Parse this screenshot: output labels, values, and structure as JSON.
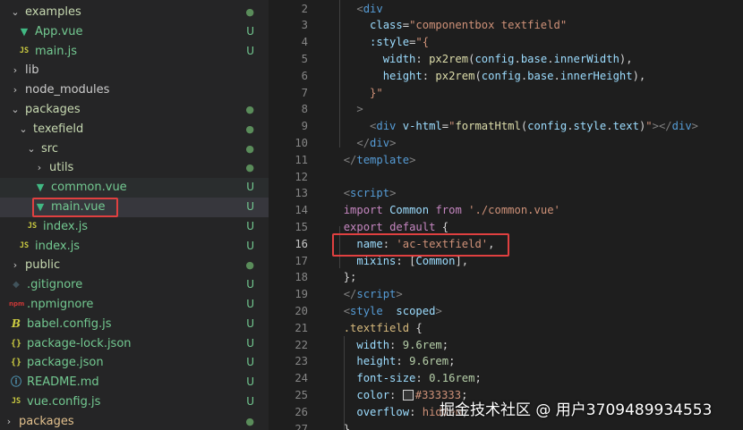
{
  "explorer": {
    "items": [
      {
        "label": "examples",
        "type": "folder-open",
        "depth": 0,
        "status": "dot",
        "style": "normal"
      },
      {
        "label": "App.vue",
        "type": "vue",
        "depth": 1,
        "status": "U",
        "style": "modified"
      },
      {
        "label": "main.js",
        "type": "js",
        "depth": 1,
        "status": "U",
        "style": "modified"
      },
      {
        "label": "lib",
        "type": "folder-closed",
        "depth": 0,
        "status": "",
        "style": "normal"
      },
      {
        "label": "node_modules",
        "type": "folder-closed",
        "depth": 0,
        "status": "",
        "style": "normal"
      },
      {
        "label": "packages",
        "type": "folder-open",
        "depth": 0,
        "status": "dot",
        "style": "normal"
      },
      {
        "label": "texefield",
        "type": "folder-open",
        "depth": 1,
        "status": "dot",
        "style": "normal"
      },
      {
        "label": "src",
        "type": "folder-open",
        "depth": 2,
        "status": "dot",
        "style": "normal"
      },
      {
        "label": "utils",
        "type": "folder-closed",
        "depth": 3,
        "status": "dot",
        "style": "normal"
      },
      {
        "label": "common.vue",
        "type": "vue",
        "depth": 3,
        "status": "U",
        "style": "modified"
      },
      {
        "label": "main.vue",
        "type": "vue",
        "depth": 3,
        "status": "U",
        "style": "modified"
      },
      {
        "label": "index.js",
        "type": "js",
        "depth": 2,
        "status": "U",
        "style": "modified"
      },
      {
        "label": "index.js",
        "type": "js",
        "depth": 1,
        "status": "U",
        "style": "modified"
      },
      {
        "label": "public",
        "type": "folder-closed",
        "depth": 0,
        "status": "dot",
        "style": "normal"
      },
      {
        "label": ".gitignore",
        "type": "git",
        "depth": 0,
        "status": "U",
        "style": "modified"
      },
      {
        "label": ".npmignore",
        "type": "npm",
        "depth": 0,
        "status": "U",
        "style": "modified"
      },
      {
        "label": "babel.config.js",
        "type": "babel",
        "depth": 0,
        "status": "U",
        "style": "modified"
      },
      {
        "label": "package-lock.json",
        "type": "json",
        "depth": 0,
        "status": "U",
        "style": "modified"
      },
      {
        "label": "package.json",
        "type": "json",
        "depth": 0,
        "status": "U",
        "style": "modified"
      },
      {
        "label": "README.md",
        "type": "info",
        "depth": 0,
        "status": "U",
        "style": "modified"
      },
      {
        "label": "vue.config.js",
        "type": "js",
        "depth": 0,
        "status": "U",
        "style": "modified"
      },
      {
        "label": "packages",
        "type": "folder-closed",
        "depth": -1,
        "status": "dot",
        "style": "bottom"
      }
    ],
    "selected_index": 10,
    "hover_index": 9
  },
  "editor": {
    "current_line": 16,
    "lines": [
      {
        "n": "2",
        "tokens": [
          [
            "    ",
            "t"
          ],
          [
            "<",
            "g"
          ],
          [
            "div",
            "tag"
          ]
        ]
      },
      {
        "n": "3",
        "tokens": [
          [
            "      ",
            "t"
          ],
          [
            "class",
            "attr"
          ],
          [
            "=",
            "t"
          ],
          [
            "\"componentbox textfield\"",
            "str"
          ]
        ]
      },
      {
        "n": "4",
        "tokens": [
          [
            "      ",
            "t"
          ],
          [
            ":style",
            "attr"
          ],
          [
            "=",
            "t"
          ],
          [
            "\"{",
            "str"
          ]
        ]
      },
      {
        "n": "5",
        "tokens": [
          [
            "        ",
            "t"
          ],
          [
            "width",
            "prop"
          ],
          [
            ": ",
            "t"
          ],
          [
            "px2rem",
            "fn"
          ],
          [
            "(",
            "t"
          ],
          [
            "config",
            "prop"
          ],
          [
            ".",
            "t"
          ],
          [
            "base",
            "prop"
          ],
          [
            ".",
            "t"
          ],
          [
            "innerWidth",
            "prop"
          ],
          [
            "),",
            "t"
          ]
        ]
      },
      {
        "n": "6",
        "tokens": [
          [
            "        ",
            "t"
          ],
          [
            "height",
            "prop"
          ],
          [
            ": ",
            "t"
          ],
          [
            "px2rem",
            "fn"
          ],
          [
            "(",
            "t"
          ],
          [
            "config",
            "prop"
          ],
          [
            ".",
            "t"
          ],
          [
            "base",
            "prop"
          ],
          [
            ".",
            "t"
          ],
          [
            "innerHeight",
            "prop"
          ],
          [
            "),",
            "t"
          ]
        ]
      },
      {
        "n": "7",
        "tokens": [
          [
            "      ",
            "t"
          ],
          [
            "}\"",
            "str"
          ]
        ]
      },
      {
        "n": "8",
        "tokens": [
          [
            "    ",
            "t"
          ],
          [
            ">",
            "g"
          ]
        ]
      },
      {
        "n": "9",
        "tokens": [
          [
            "      ",
            "t"
          ],
          [
            "<",
            "g"
          ],
          [
            "div",
            "tag"
          ],
          [
            " ",
            "t"
          ],
          [
            "v-html",
            "attr"
          ],
          [
            "=",
            "t"
          ],
          [
            "\"",
            "str"
          ],
          [
            "formatHtml",
            "fn"
          ],
          [
            "(",
            "t"
          ],
          [
            "config",
            "prop"
          ],
          [
            ".",
            "t"
          ],
          [
            "style",
            "prop"
          ],
          [
            ".",
            "t"
          ],
          [
            "text",
            "prop"
          ],
          [
            ")",
            "t"
          ],
          [
            "\"",
            "str"
          ],
          [
            "></",
            "g"
          ],
          [
            "div",
            "tag"
          ],
          [
            ">",
            "g"
          ]
        ]
      },
      {
        "n": "10",
        "tokens": [
          [
            "    ",
            "t"
          ],
          [
            "</",
            "g"
          ],
          [
            "div",
            "tag"
          ],
          [
            ">",
            "g"
          ]
        ]
      },
      {
        "n": "11",
        "tokens": [
          [
            "  ",
            "t"
          ],
          [
            "</",
            "g"
          ],
          [
            "template",
            "tag"
          ],
          [
            ">",
            "g"
          ]
        ]
      },
      {
        "n": "12",
        "tokens": []
      },
      {
        "n": "13",
        "tokens": [
          [
            "  ",
            "t"
          ],
          [
            "<",
            "g"
          ],
          [
            "script",
            "tag"
          ],
          [
            ">",
            "g"
          ]
        ]
      },
      {
        "n": "14",
        "tokens": [
          [
            "  ",
            "t"
          ],
          [
            "import",
            "kw"
          ],
          [
            " ",
            "t"
          ],
          [
            "Common",
            "prop"
          ],
          [
            " ",
            "t"
          ],
          [
            "from",
            "kw"
          ],
          [
            " ",
            "t"
          ],
          [
            "'./common.vue'",
            "str"
          ]
        ]
      },
      {
        "n": "15",
        "tokens": [
          [
            "  ",
            "t"
          ],
          [
            "export",
            "kw"
          ],
          [
            " ",
            "t"
          ],
          [
            "default",
            "kw"
          ],
          [
            " ",
            "t"
          ],
          [
            "{",
            "t"
          ]
        ]
      },
      {
        "n": "16",
        "tokens": [
          [
            "    ",
            "t"
          ],
          [
            "name",
            "prop"
          ],
          [
            ": ",
            "t"
          ],
          [
            "'ac-textfield'",
            "str"
          ],
          [
            ",",
            "t"
          ]
        ]
      },
      {
        "n": "17",
        "tokens": [
          [
            "    ",
            "t"
          ],
          [
            "mixins",
            "prop"
          ],
          [
            ": [",
            "t"
          ],
          [
            "Common",
            "prop"
          ],
          [
            "],",
            "t"
          ]
        ]
      },
      {
        "n": "18",
        "tokens": [
          [
            "  ",
            "t"
          ],
          [
            "};",
            "t"
          ]
        ]
      },
      {
        "n": "19",
        "tokens": [
          [
            "  ",
            "t"
          ],
          [
            "</",
            "g"
          ],
          [
            "script",
            "tag"
          ],
          [
            ">",
            "g"
          ]
        ]
      },
      {
        "n": "20",
        "tokens": [
          [
            "  ",
            "t"
          ],
          [
            "<",
            "g"
          ],
          [
            "style",
            "tag"
          ],
          [
            "  ",
            "t"
          ],
          [
            "scoped",
            "attr"
          ],
          [
            ">",
            "g"
          ]
        ]
      },
      {
        "n": "21",
        "tokens": [
          [
            "  ",
            "t"
          ],
          [
            ".textfield",
            "sel"
          ],
          [
            " {",
            "t"
          ]
        ]
      },
      {
        "n": "22",
        "tokens": [
          [
            "    ",
            "t"
          ],
          [
            "width",
            "prop"
          ],
          [
            ": ",
            "t"
          ],
          [
            "9.6rem",
            "num"
          ],
          [
            ";",
            "t"
          ]
        ]
      },
      {
        "n": "23",
        "tokens": [
          [
            "    ",
            "t"
          ],
          [
            "height",
            "prop"
          ],
          [
            ": ",
            "t"
          ],
          [
            "9.6rem",
            "num"
          ],
          [
            ";",
            "t"
          ]
        ]
      },
      {
        "n": "24",
        "tokens": [
          [
            "    ",
            "t"
          ],
          [
            "font-size",
            "prop"
          ],
          [
            ": ",
            "t"
          ],
          [
            "0.16rem",
            "num"
          ],
          [
            ";",
            "t"
          ]
        ]
      },
      {
        "n": "25",
        "tokens": [
          [
            "    ",
            "t"
          ],
          [
            "color",
            "prop"
          ],
          [
            ": ",
            "t"
          ],
          [
            "#333333",
            "str"
          ],
          [
            ";",
            "t"
          ]
        ]
      },
      {
        "n": "26",
        "tokens": [
          [
            "    ",
            "t"
          ],
          [
            "overflow",
            "prop"
          ],
          [
            ": ",
            "t"
          ],
          [
            "hidden",
            "str"
          ],
          [
            ";",
            "t"
          ]
        ]
      },
      {
        "n": "27",
        "tokens": [
          [
            "  ",
            "t"
          ],
          [
            "}",
            "t"
          ]
        ]
      }
    ]
  },
  "colors": {
    "t": "#d4d4d4",
    "g": "#808080",
    "tag": "#569cd6",
    "attr": "#9cdcfe",
    "str": "#ce9178",
    "prop": "#9cdcfe",
    "fn": "#dcdcaa",
    "kw": "#c586c0",
    "sel": "#d7ba7d",
    "num": "#b5cea8"
  },
  "watermark": {
    "text": "掘金技术社区 @ 用户3709489934553"
  }
}
